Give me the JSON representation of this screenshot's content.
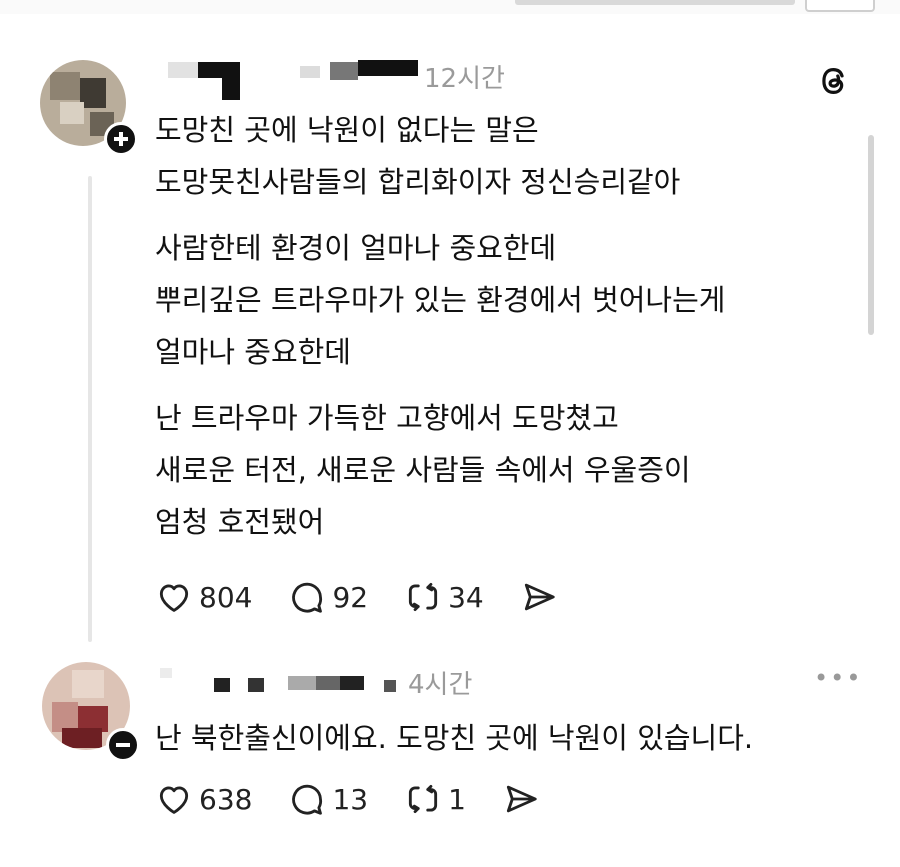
{
  "posts": [
    {
      "time": "12시간",
      "body": {
        "paragraphs": [
          [
            "도망친 곳에 낙원이 없다는 말은",
            "도망못친사람들의 합리화이자 정신승리같아"
          ],
          [
            "사람한테 환경이 얼마나 중요한데",
            "뿌리깊은 트라우마가 있는 환경에서 벗어나는게",
            "얼마나 중요한데"
          ],
          [
            "난 트라우마 가득한 고향에서 도망쳤고",
            "새로운 터전, 새로운 사람들 속에서 우울증이",
            "엄청 호전됐어"
          ]
        ]
      },
      "likes": "804",
      "replies": "92",
      "reposts": "34"
    },
    {
      "time": "4시간",
      "more_label": "•••",
      "body": {
        "paragraphs": [
          [
            "난 북한출신이에요. 도망친 곳에 낙원이 있습니다."
          ]
        ]
      },
      "likes": "638",
      "replies": "13",
      "reposts": "1"
    }
  ],
  "icons": {
    "brand": "threads-logo-icon",
    "like": "heart-icon",
    "reply": "comment-icon",
    "repost": "repost-icon",
    "share": "send-icon"
  },
  "colors": {
    "text": "#111111",
    "muted": "#9a9a9a",
    "divider": "#e6e6e6"
  }
}
